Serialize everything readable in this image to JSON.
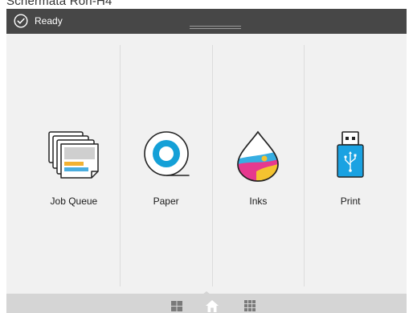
{
  "document_caption": "Schermata Ron-H4",
  "status_bar": {
    "status": "Ready",
    "icon": "check-circle-icon"
  },
  "tiles": [
    {
      "label": "Job Queue",
      "icon": "job-queue-icon"
    },
    {
      "label": "Paper",
      "icon": "paper-roll-icon"
    },
    {
      "label": "Inks",
      "icon": "ink-drop-icon"
    },
    {
      "label": "Print",
      "icon": "usb-drive-icon"
    }
  ],
  "bottom_nav": {
    "items": [
      {
        "icon": "widgets-icon"
      },
      {
        "icon": "home-icon",
        "selected": true
      },
      {
        "icon": "apps-grid-icon"
      }
    ]
  },
  "colors": {
    "status_bar_bg": "#474747",
    "screen_bg": "#f1f1f1",
    "nav_bar_bg": "#d5d5d5",
    "paper_cyan": "#14a0d7",
    "ink_magenta": "#e6398f",
    "ink_cyan": "#37aee2",
    "ink_yellow": "#f4c330",
    "usb_blue": "#1aa2e2"
  }
}
